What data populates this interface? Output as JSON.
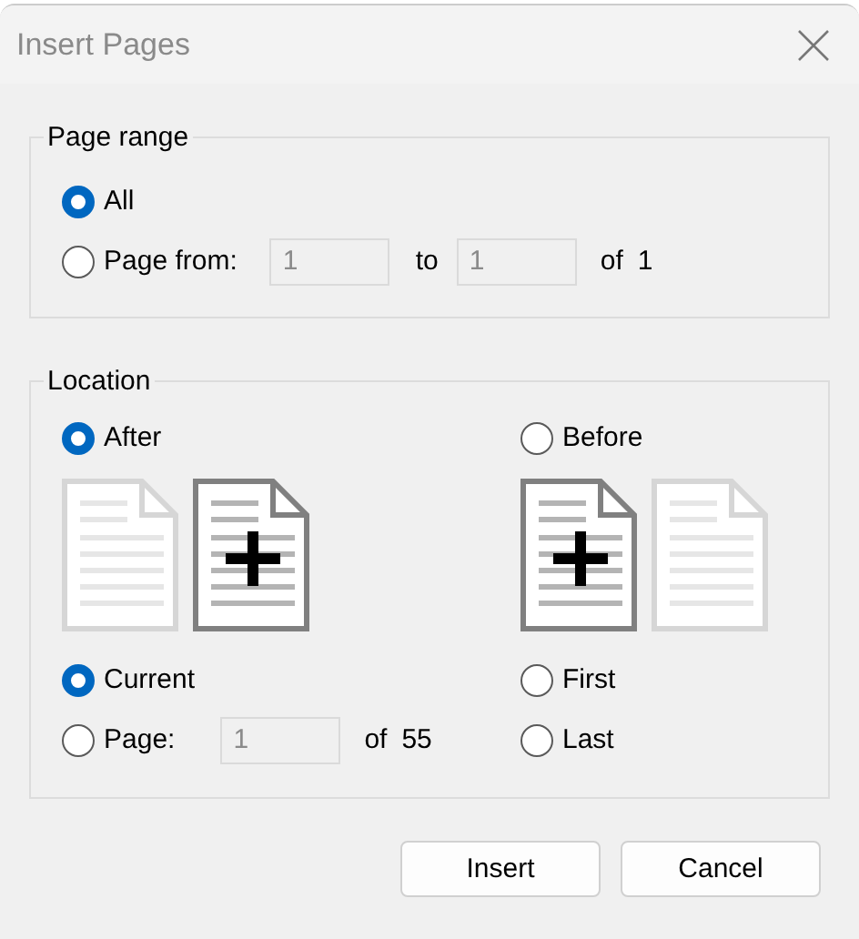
{
  "window": {
    "title": "Insert Pages"
  },
  "page_range": {
    "label": "Page range",
    "options": [
      {
        "label": "All",
        "selected": true
      },
      {
        "label": "Page from:",
        "selected": false
      }
    ],
    "from_field": {
      "value": "1"
    },
    "to_label": "to",
    "to_field": {
      "value": "1"
    },
    "of_label": "of",
    "total": "1"
  },
  "location": {
    "label": "Location",
    "position": [
      {
        "label": "After",
        "selected": true
      },
      {
        "label": "Before",
        "selected": false
      }
    ],
    "target": [
      {
        "label": "Current",
        "selected": true
      },
      {
        "label": "Page:",
        "selected": false
      },
      {
        "label": "First",
        "selected": false
      },
      {
        "label": "Last",
        "selected": false
      }
    ],
    "page_field": {
      "value": "1"
    },
    "of_label": "of",
    "total": "55"
  },
  "buttons": [
    {
      "label": "Insert"
    },
    {
      "label": "Cancel"
    }
  ]
}
